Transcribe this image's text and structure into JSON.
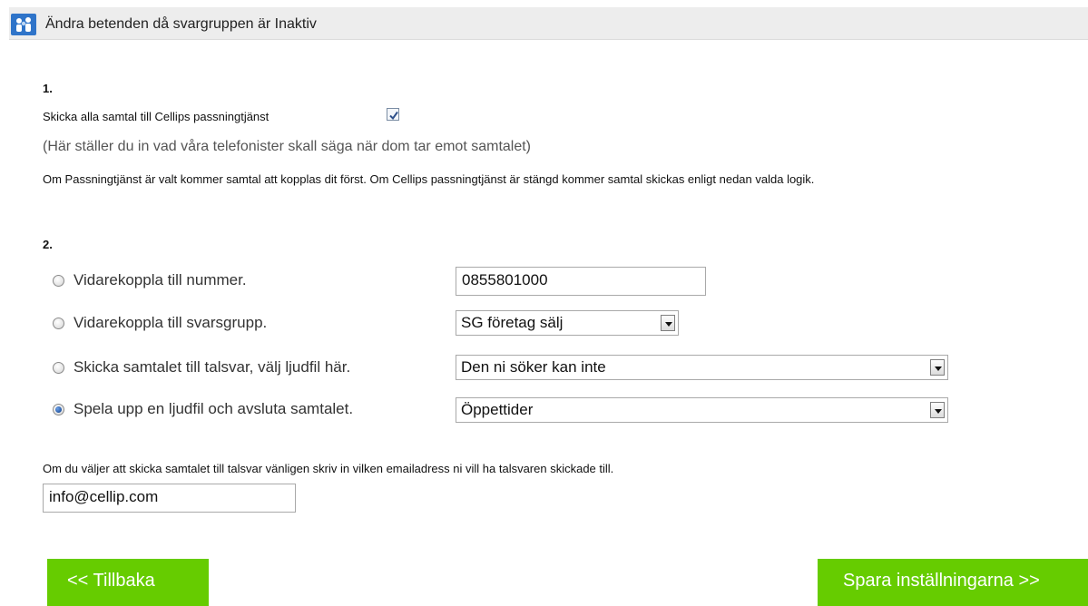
{
  "header": {
    "title": "Ändra betenden då svargruppen är Inaktiv"
  },
  "section1": {
    "step": "1.",
    "checkbox_label": "Skicka alla samtal till Cellips passningtjänst",
    "checkbox_checked": true,
    "note": "(Här ställer du in vad våra telefonister skall säga när dom tar emot samtalet)",
    "description": "Om Passningtjänst är valt kommer samtal att kopplas dit först. Om Cellips passningtjänst är stängd kommer samtal skickas enligt nedan valda logik."
  },
  "section2": {
    "step": "2.",
    "options": [
      {
        "label": "Vidarekoppla till nummer.",
        "selected": false,
        "value": "0855801000"
      },
      {
        "label": "Vidarekoppla till svarsgrupp.",
        "selected": false,
        "value": "SG företag sälj"
      },
      {
        "label": "Skicka samtalet till talsvar, välj ljudfil här.",
        "selected": false,
        "value": "Den ni söker kan inte"
      },
      {
        "label": "Spela upp en ljudfil och avsluta samtalet.",
        "selected": true,
        "value": "Öppettider"
      }
    ]
  },
  "email": {
    "prompt": "Om du väljer att skicka samtalet till talsvar vänligen skriv in vilken emailadress ni vill ha talsvaren skickade till.",
    "value": "info@cellip.com"
  },
  "buttons": {
    "back": "<< Tillbaka",
    "save": "Spara inställningarna >>"
  },
  "colors": {
    "button_green": "#66cc00",
    "header_bg": "#ededed",
    "logo_blue": "#2f74c9"
  },
  "icons": {
    "logo": "group-users-icon",
    "checkbox": "checkmark-icon"
  }
}
